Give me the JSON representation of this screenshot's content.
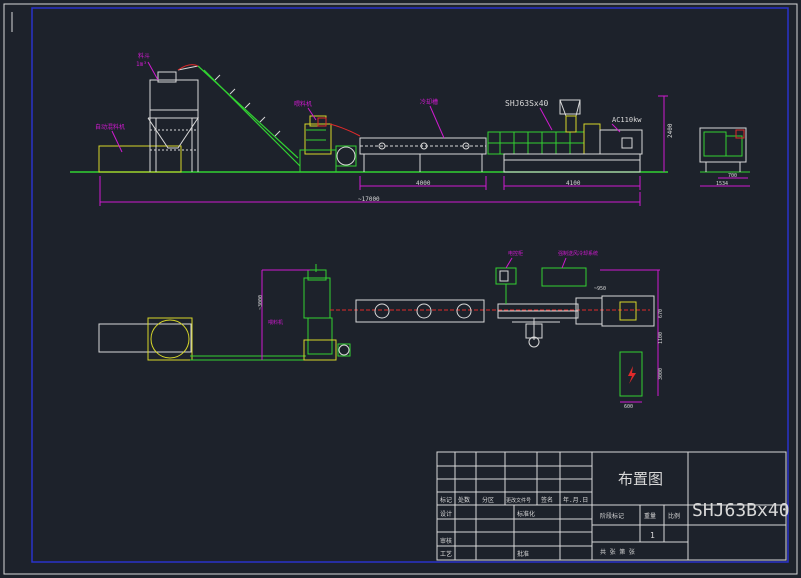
{
  "colors": {
    "background": "#1d222b",
    "border": "#2a33c9",
    "white": "#d8d8d8",
    "green": "#32d232",
    "magenta": "#d01ad0",
    "red": "#e02a2a",
    "yellow": "#d6d62a",
    "cyan": "#2ad6d6"
  },
  "elevation": {
    "hopper_label": "料斗",
    "hopper_volume": "1m³",
    "mixer_label": "自动混料机",
    "feeder_label": "喂料机",
    "cooling_label": "冷却槽",
    "extruder_model": "SHJ63Sx40",
    "motor_label": "AC110kw",
    "dim_cooling": "4000",
    "dim_extruder": "4100",
    "dim_total": "~17000",
    "dim_height": "2400",
    "dim_side_width": "1534",
    "dim_side_small": "700"
  },
  "plan": {
    "feeder_label": "喂料机",
    "control_label": "电控柜",
    "cabinet_label": "强制送风冷却系统",
    "dim_vertical": "~3000",
    "dim_a": "~950",
    "dim_b": "1100",
    "dim_c": "670",
    "dim_d": "3000",
    "dim_e": "600"
  },
  "title_block": {
    "drawing_title": "布置图",
    "model": "SHJ63Bx40",
    "row1": [
      "标记",
      "处数",
      "分区",
      "更改文件号",
      "签名",
      "年.月.日"
    ],
    "row2": [
      "设计",
      "",
      "标准化"
    ],
    "stage_label": "阶段标记",
    "weight_label": "重量",
    "scale_label": "比例",
    "sheet_number": "1",
    "row3": [
      "审核"
    ],
    "row4": [
      "工艺",
      "",
      "批准"
    ],
    "sheets_label": "共 张 第 张"
  }
}
